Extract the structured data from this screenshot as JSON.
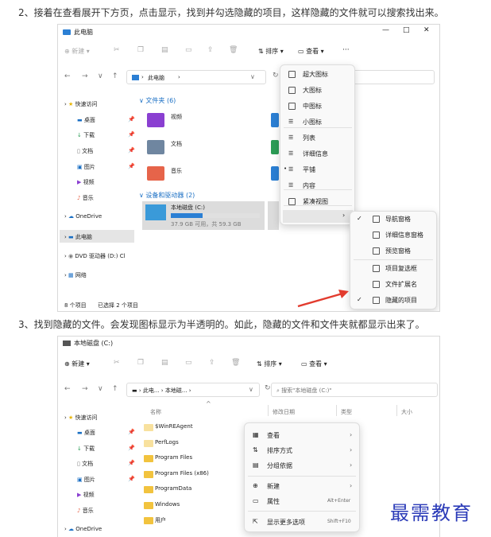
{
  "steps": {
    "step2": "2、接着在查看展开下方页，点击显示，找到并勾选隐藏的项目，这样隐藏的文件就可以搜索找出来。",
    "step3": "3、找到隐藏的文件。会发现图标显示为半透明的。如此，隐藏的文件和文件夹就都显示出来了。"
  },
  "watermark": "最需教育",
  "window1": {
    "title": "此电脑",
    "toolbar": {
      "new": "新建",
      "sort": "排序",
      "view": "查看",
      "more": "···"
    },
    "address": "此电脑",
    "sidebar": [
      {
        "label": "快速访问",
        "icon": "star-icon"
      },
      {
        "label": "桌面",
        "icon": "desktop-icon"
      },
      {
        "label": "下载",
        "icon": "download-icon"
      },
      {
        "label": "文档",
        "icon": "document-icon"
      },
      {
        "label": "图片",
        "icon": "picture-icon"
      },
      {
        "label": "视频",
        "icon": "video-icon"
      },
      {
        "label": "音乐",
        "icon": "music-icon"
      },
      {
        "label": "OneDrive",
        "icon": "cloud-icon"
      },
      {
        "label": "此电脑",
        "icon": "computer-icon"
      },
      {
        "label": "DVD 驱动器 (D:) Cl",
        "icon": "dvd-icon"
      },
      {
        "label": "网络",
        "icon": "network-icon"
      }
    ],
    "folders_header": "文件夹 (6)",
    "folders": [
      {
        "label": "视频",
        "color": "#8a3fd1"
      },
      {
        "label": "文档",
        "color": "#6f86a0"
      },
      {
        "label": "音乐",
        "color": "#e6644a"
      }
    ],
    "devices_header": "设备和驱动器 (2)",
    "drive": {
      "name": "本地磁盘 (C:)",
      "free": "37.9 GB 可用，共 59.3 GB",
      "used_fraction": 0.36
    },
    "status": {
      "count": "8 个项目",
      "selected": "已选择 2 个项目"
    },
    "view_menu": [
      "超大图标",
      "大图标",
      "中图标",
      "小图标",
      "列表",
      "详细信息",
      "平铺",
      "内容",
      "紧凑视图",
      "显示"
    ],
    "show_menu": [
      "导航窗格",
      "详细信息窗格",
      "预览窗格",
      "项目复选框",
      "文件扩展名",
      "隐藏的项目"
    ]
  },
  "window2": {
    "title": "本地磁盘 (C:)",
    "toolbar": {
      "new": "新建",
      "sort": "排序",
      "view": "查看"
    },
    "breadcrumb": [
      "此电...",
      "本地磁...",
      ""
    ],
    "search_placeholder": "搜索\"本地磁盘 (C:)\"",
    "columns": [
      "名称",
      "修改日期",
      "类型",
      "大小"
    ],
    "files": [
      "$WinREAgent",
      "PerfLogs",
      "Program Files",
      "Program Files (x86)",
      "ProgramData",
      "Windows",
      "用户"
    ],
    "sidebar": [
      {
        "label": "快速访问",
        "icon": "star-icon"
      },
      {
        "label": "桌面",
        "icon": "desktop-icon"
      },
      {
        "label": "下载",
        "icon": "download-icon"
      },
      {
        "label": "文档",
        "icon": "document-icon"
      },
      {
        "label": "图片",
        "icon": "picture-icon"
      },
      {
        "label": "视频",
        "icon": "video-icon"
      },
      {
        "label": "音乐",
        "icon": "music-icon"
      },
      {
        "label": "OneDrive",
        "icon": "cloud-icon"
      }
    ],
    "context_menu": [
      {
        "label": "查看",
        "shortcut": ""
      },
      {
        "label": "排序方式",
        "shortcut": ""
      },
      {
        "label": "分组依据",
        "shortcut": ""
      },
      {
        "label": "新建",
        "shortcut": ""
      },
      {
        "label": "属性",
        "shortcut": "Alt+Enter"
      },
      {
        "label": "显示更多选项",
        "shortcut": "Shift+F10"
      }
    ]
  }
}
